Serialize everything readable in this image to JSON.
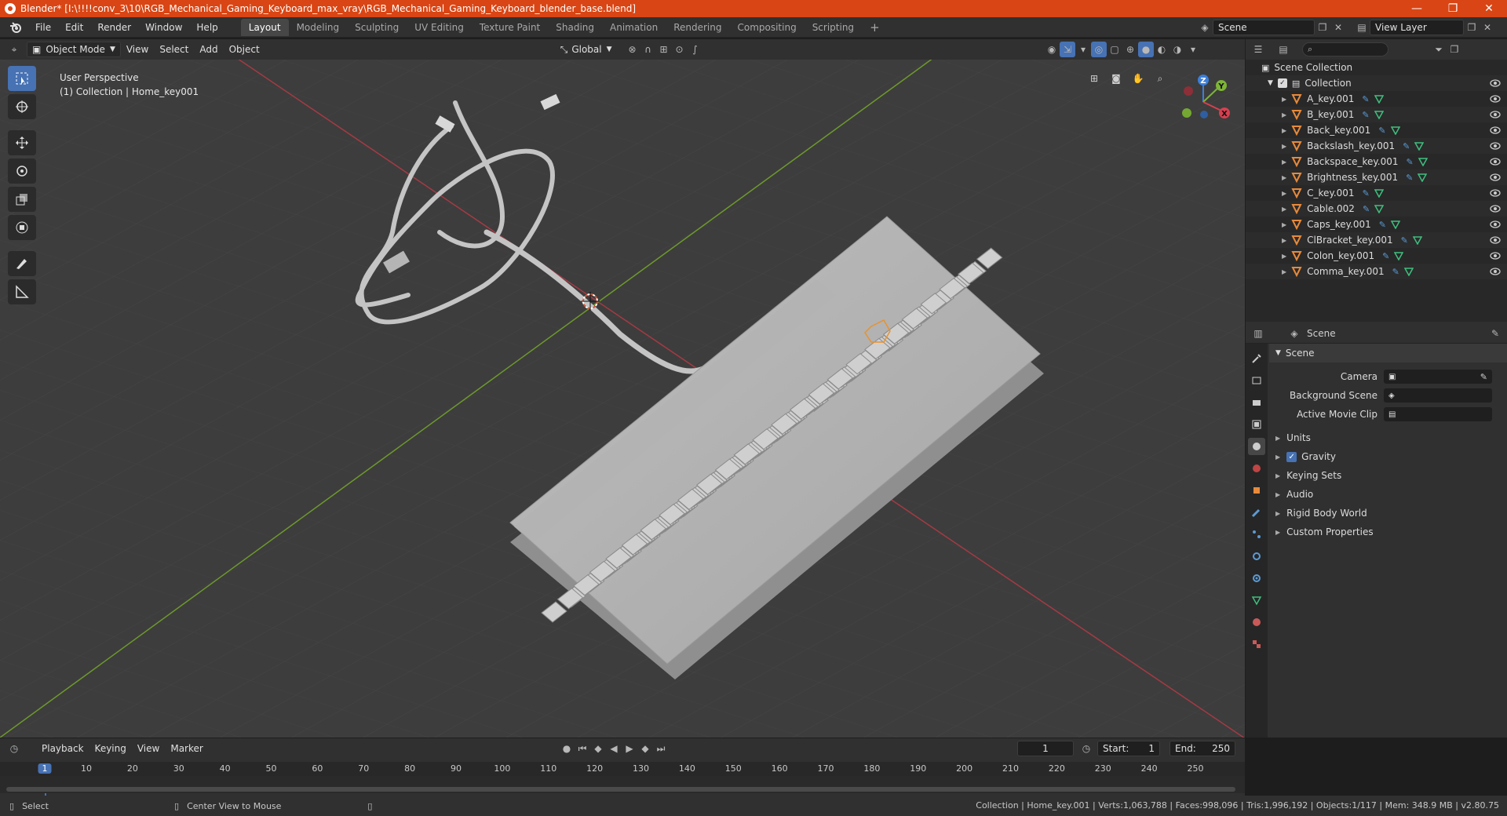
{
  "window": {
    "title": "Blender* [I:\\!!!!conv_3\\10\\RGB_Mechanical_Gaming_Keyboard_max_vray\\RGB_Mechanical_Gaming_Keyboard_blender_base.blend]",
    "controls": [
      "—",
      "❐",
      "✕"
    ]
  },
  "menu": [
    "File",
    "Edit",
    "Render",
    "Window",
    "Help"
  ],
  "workspaces": [
    {
      "label": "Layout",
      "active": true
    },
    {
      "label": "Modeling"
    },
    {
      "label": "Sculpting"
    },
    {
      "label": "UV Editing"
    },
    {
      "label": "Texture Paint"
    },
    {
      "label": "Shading"
    },
    {
      "label": "Animation"
    },
    {
      "label": "Rendering"
    },
    {
      "label": "Compositing"
    },
    {
      "label": "Scripting"
    }
  ],
  "scene_selector": "Scene",
  "view_layer": "View Layer",
  "viewport_header": {
    "mode": "Object Mode",
    "menus": [
      "View",
      "Select",
      "Add",
      "Object"
    ],
    "transform_orientation": "Global"
  },
  "viewport": {
    "perspective_label": "User Perspective",
    "collection_label": "(1) Collection | Home_key001",
    "gizmo_axes": [
      "Z",
      "Y",
      "X"
    ]
  },
  "outliner": {
    "root": "Scene Collection",
    "collection": "Collection",
    "items": [
      "A_key.001",
      "B_key.001",
      "Back_key.001",
      "Backslash_key.001",
      "Backspace_key.001",
      "Brightness_key.001",
      "C_key.001",
      "Cable.002",
      "Caps_key.001",
      "ClBracket_key.001",
      "Colon_key.001",
      "Comma_key.001"
    ]
  },
  "properties": {
    "context": "Scene",
    "section": "Scene",
    "fields": [
      {
        "label": "Camera",
        "value": ""
      },
      {
        "label": "Background Scene",
        "value": ""
      },
      {
        "label": "Active Movie Clip",
        "value": ""
      }
    ],
    "subsections": [
      {
        "label": "Units",
        "checkbox": false
      },
      {
        "label": "Gravity",
        "checkbox": true
      },
      {
        "label": "Keying Sets",
        "checkbox": false
      },
      {
        "label": "Audio",
        "checkbox": false
      },
      {
        "label": "Rigid Body World",
        "checkbox": false
      },
      {
        "label": "Custom Properties",
        "checkbox": false
      }
    ]
  },
  "timeline": {
    "menus": [
      "Playback",
      "Keying",
      "View",
      "Marker"
    ],
    "current_frame": "1",
    "start_label": "Start:",
    "start": "1",
    "end_label": "End:",
    "end": "250",
    "ruler": [
      "1",
      "10",
      "20",
      "30",
      "40",
      "50",
      "60",
      "70",
      "80",
      "90",
      "100",
      "110",
      "120",
      "130",
      "140",
      "150",
      "160",
      "170",
      "180",
      "190",
      "200",
      "210",
      "220",
      "230",
      "240",
      "250"
    ]
  },
  "status": {
    "select": "Select",
    "center_view": "Center View to Mouse",
    "stats": "Collection | Home_key.001 | Verts:1,063,788 | Faces:998,096 | Tris:1,996,192 | Objects:1/117 | Mem: 348.9 MB | v2.80.75"
  },
  "colors": {
    "accent": "#4772b3",
    "titlebar": "#d94514",
    "x_axis": "#d6404f",
    "y_axis": "#7db536",
    "z_axis": "#3b7fd8"
  }
}
